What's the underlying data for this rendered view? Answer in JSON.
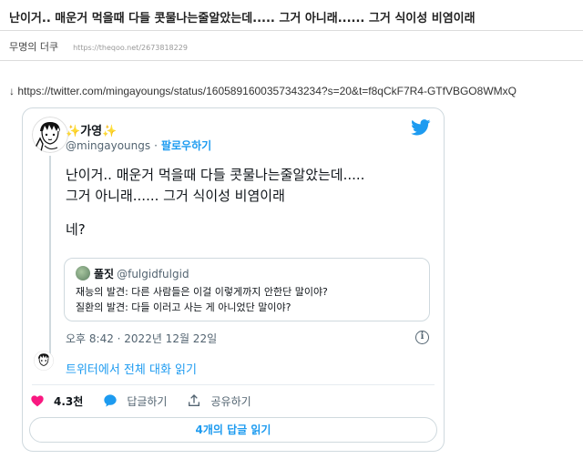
{
  "post": {
    "title": "난이거.. 매운거 먹을때 다들 콧물나는줄알았는데..... 그거 아니래...... 그거 식이성 비염이래",
    "author": "무명의 더쿠",
    "url": "https://theqoo.net/2673818229"
  },
  "source": {
    "arrow": "↓",
    "link": "https://twitter.com/mingayoungs/status/1605891600357343234?s=20&t=f8qCkF7R4-GTfVBGO8WMxQ"
  },
  "tweet": {
    "display_name": "가영",
    "sparkle": "✨",
    "handle": "@mingayoungs",
    "dot": "·",
    "follow_label": "팔로우하기",
    "lines": [
      "난이거.. 매운거 먹을때 다들 콧물나는줄알았는데.....",
      "그거 아니래...... 그거 식이성 비염이래",
      "네?"
    ],
    "quote": {
      "name": "풀짓",
      "handle": "@fulgidfulgid",
      "lines": [
        "재능의 발견: 다른 사람들은 이걸 이렇게까지 안한단 말이야?",
        "질환의 발견: 다들 이러고 사는 게 아니었단 말이야?"
      ]
    },
    "timestamp": "오후 8:42 · 2022년 12월 22일",
    "info_glyph": "i",
    "read_conversation": "트위터에서 전체 대화 읽기",
    "likes": "4.3천",
    "reply_label": "답글하기",
    "share_label": "공유하기",
    "more_replies": "4개의 답글 읽기"
  },
  "colors": {
    "twitter_blue": "#1d9bf0",
    "like_red": "#f91880",
    "muted": "#536471",
    "border": "#cfd9de"
  },
  "icons": [
    "twitter-bird-icon",
    "heart-icon",
    "reply-bubble-icon",
    "share-icon",
    "info-icon"
  ]
}
